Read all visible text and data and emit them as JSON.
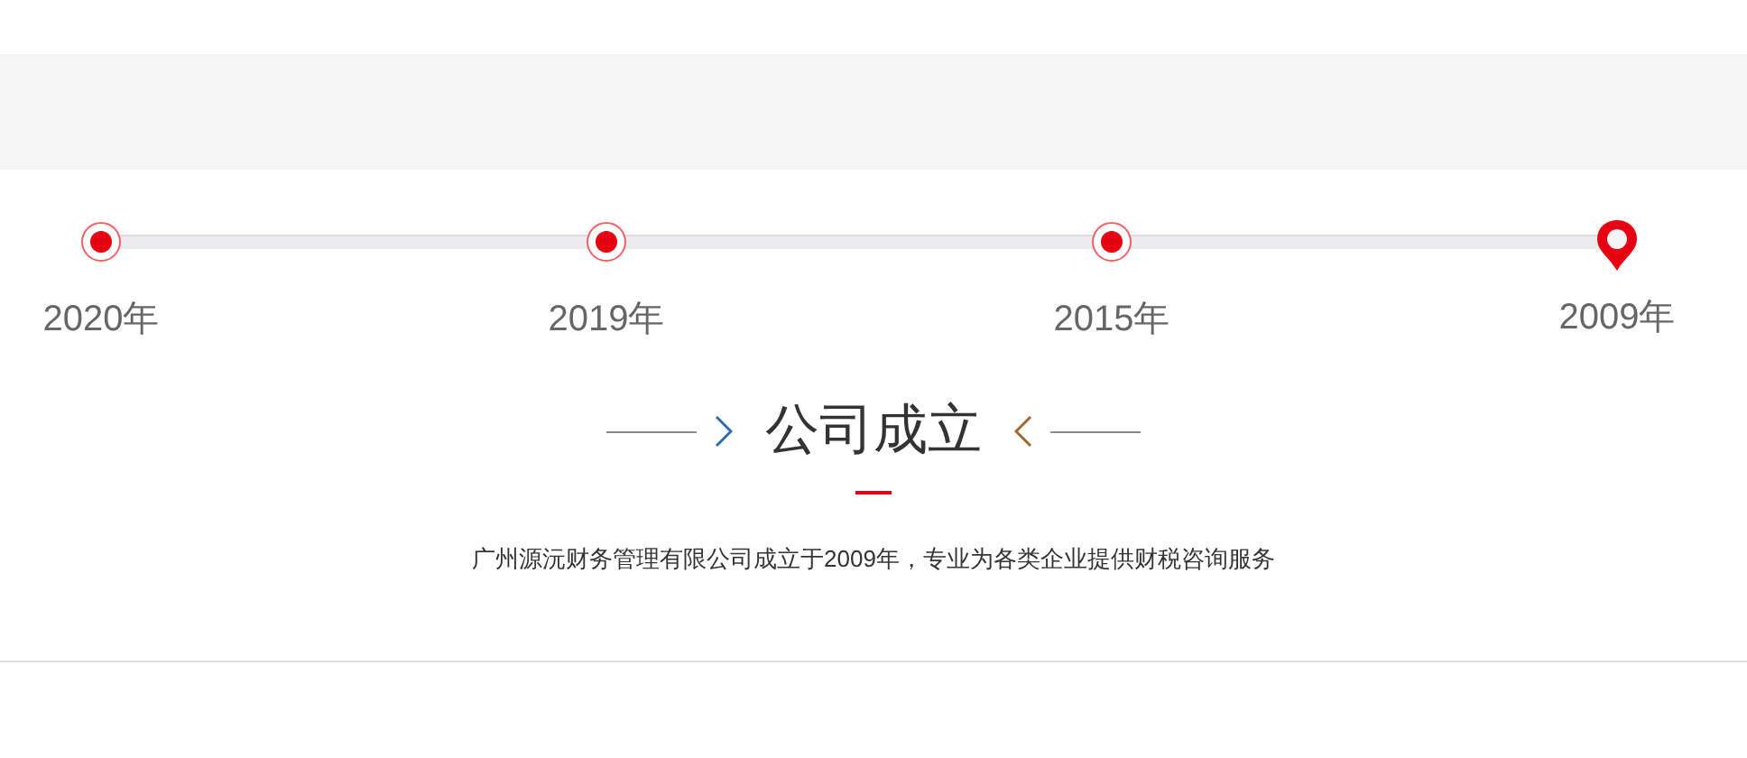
{
  "timeline": [
    {
      "year": "2020年",
      "selected": false
    },
    {
      "year": "2019年",
      "selected": false
    },
    {
      "year": "2015年",
      "selected": false
    },
    {
      "year": "2009年",
      "selected": true
    }
  ],
  "detail": {
    "title": "公司成立",
    "text": "广州源沅财务管理有限公司成立于2009年，专业为各类企业提供财税咨询服务"
  }
}
